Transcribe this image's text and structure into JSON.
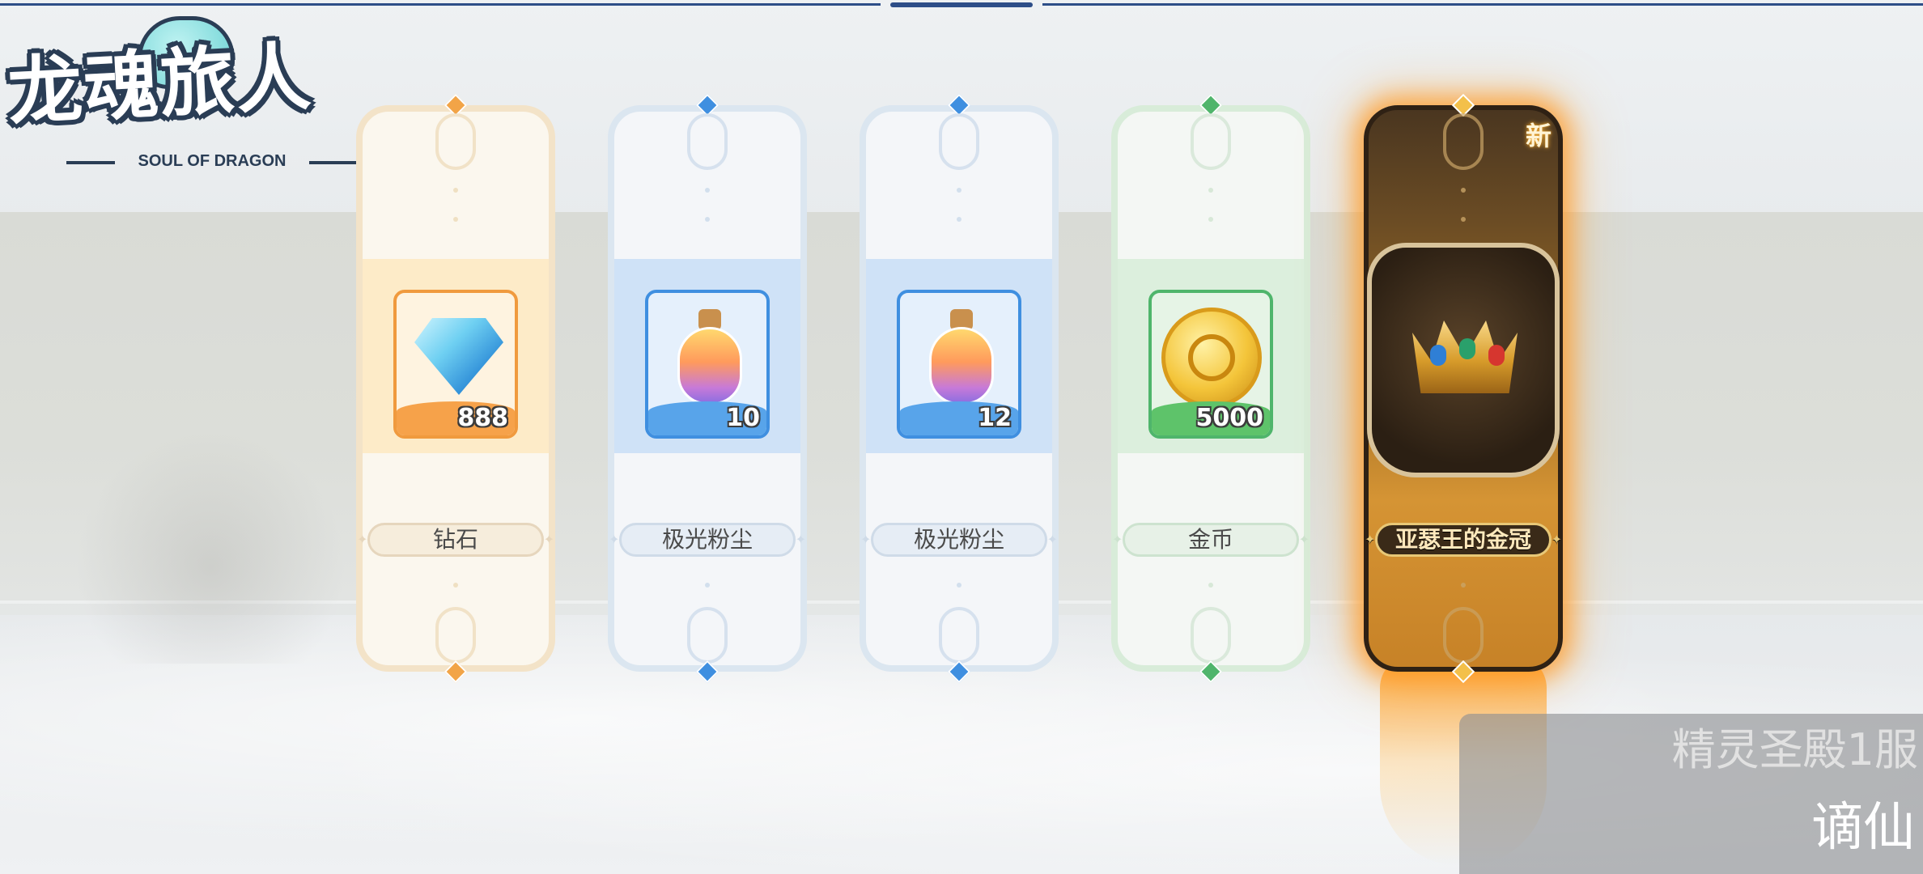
{
  "logo": {
    "title": "龙魂旅人",
    "subtitle": "SOUL OF DRAGON"
  },
  "rewards": [
    {
      "name": "钻石",
      "quantity": "888",
      "icon": "diamond-icon",
      "accent": "#f2a447"
    },
    {
      "name": "极光粉尘",
      "quantity": "10",
      "icon": "aurora-dust-bottle-icon",
      "accent": "#3f8fe0"
    },
    {
      "name": "极光粉尘",
      "quantity": "12",
      "icon": "aurora-dust-bottle-icon",
      "accent": "#3f8fe0"
    },
    {
      "name": "金币",
      "quantity": "5000",
      "icon": "gold-coin-icon",
      "accent": "#4fb56b"
    },
    {
      "name": "亚瑟王的金冠",
      "quantity": "",
      "icon": "golden-crown-icon",
      "accent": "#f3a72f",
      "badge": "新"
    }
  ],
  "server_panel": {
    "server_name": "精灵圣殿1服",
    "player_name": "谪仙"
  }
}
